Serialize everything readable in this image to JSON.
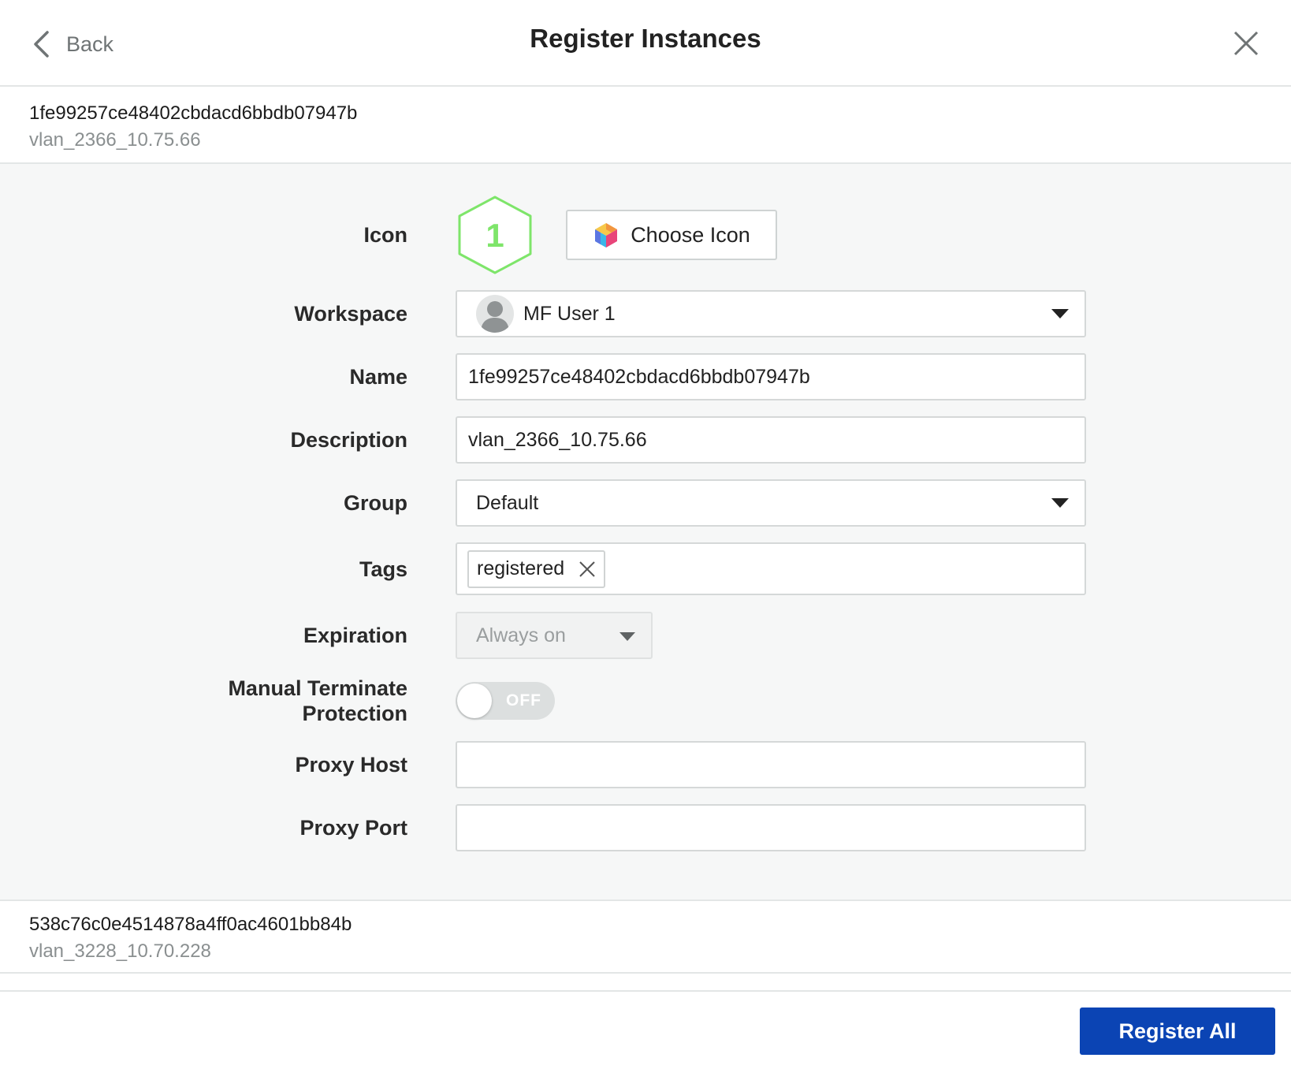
{
  "dialog": {
    "back_label": "Back",
    "title": "Register Instances",
    "close_icon": "close-icon"
  },
  "instances": [
    {
      "id": "1fe99257ce48402cbdacd6bbdb07947b",
      "description": "vlan_2366_10.75.66"
    },
    {
      "id": "538c76c0e4514878a4ff0ac4601bb84b",
      "description": "vlan_3228_10.70.228"
    }
  ],
  "form": {
    "icon_label": "Icon",
    "icon_number": "1",
    "icon_color": "#7ee56a",
    "choose_icon_label": "Choose Icon",
    "workspace_label": "Workspace",
    "workspace_value": "MF User 1",
    "name_label": "Name",
    "name_value": "1fe99257ce48402cbdacd6bbdb07947b",
    "description_label": "Description",
    "description_value": "vlan_2366_10.75.66",
    "group_label": "Group",
    "group_value": "Default",
    "tags_label": "Tags",
    "tags": [
      "registered"
    ],
    "expiration_label": "Expiration",
    "expiration_value": "Always on",
    "manual_terminate_label_line1": "Manual Terminate",
    "manual_terminate_label_line2": "Protection",
    "manual_terminate_state": "OFF",
    "proxy_host_label": "Proxy Host",
    "proxy_host_value": "",
    "proxy_port_label": "Proxy Port",
    "proxy_port_value": ""
  },
  "footer": {
    "register_all_label": "Register All",
    "primary_color": "#0b44b4"
  }
}
